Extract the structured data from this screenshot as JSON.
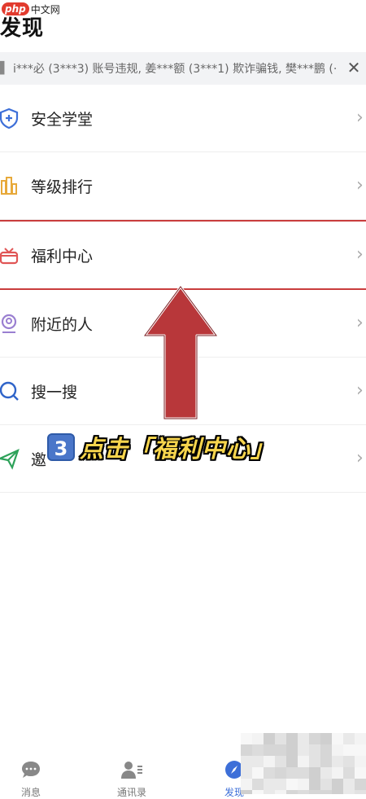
{
  "watermark": {
    "logo": "php",
    "text": "中文网"
  },
  "header": {
    "title": "发现"
  },
  "ticker": {
    "text": "i***必 (3***3) 账号违规, 姜***额 (3***1) 欺诈骗钱, 樊***鹏 (·",
    "close": "✕"
  },
  "menu": {
    "items": [
      {
        "label": "安全学堂"
      },
      {
        "label": "等级排行"
      },
      {
        "label": "福利中心"
      },
      {
        "label": "附近的人"
      },
      {
        "label": "搜一搜"
      },
      {
        "label": "邀"
      }
    ],
    "chevron": "›"
  },
  "caption": {
    "step": "3",
    "text": "点击「福利中心」"
  },
  "bottom_nav": {
    "items": [
      {
        "label": "消息"
      },
      {
        "label": "通讯录"
      },
      {
        "label": "发现"
      }
    ]
  },
  "colors": {
    "accent": "#3d6fd8",
    "highlight": "#c93d3d",
    "arrow": "#b8373a",
    "caption": "#f7d54d"
  }
}
